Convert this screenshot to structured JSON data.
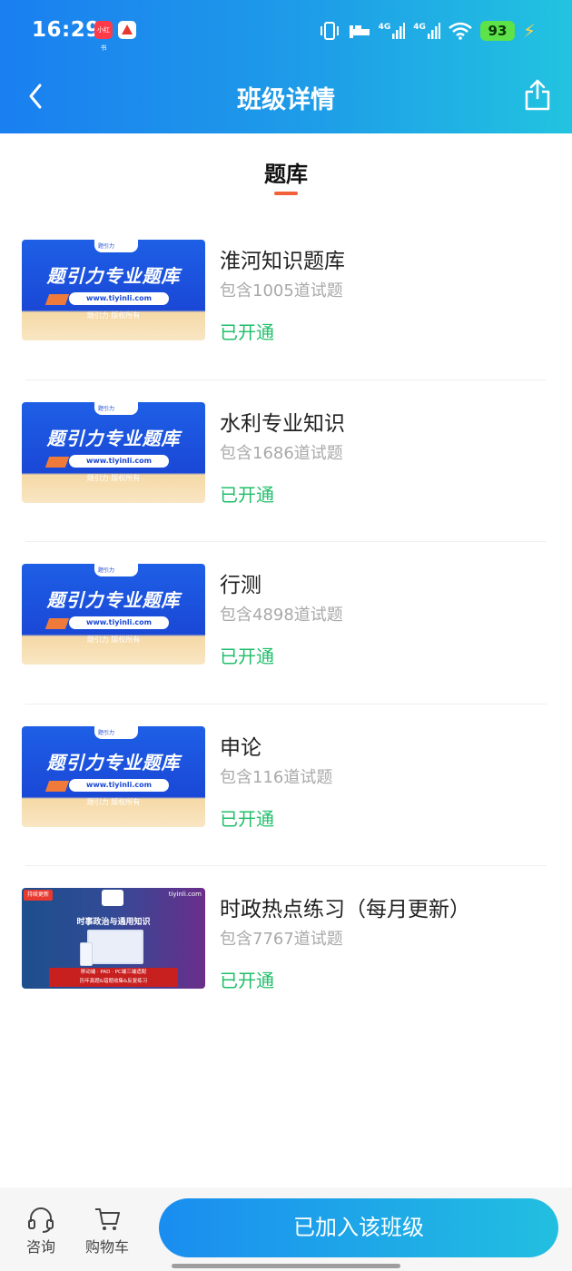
{
  "status_bar": {
    "time": "16:29",
    "app_badge_text": "小红书",
    "network_label_1": "4G",
    "network_label_2": "4G",
    "battery_level": "93"
  },
  "nav": {
    "title": "班级详情"
  },
  "tabs": [
    {
      "label": "题库",
      "active": true
    }
  ],
  "thumbnail_standard": {
    "brand_small": "题引力",
    "headline": "题引力专业题库",
    "url": "www.tiyinli.com",
    "copyright": "题引力 版权所有"
  },
  "thumbnail_alt": {
    "tag": "持续更新",
    "domain": "tiyinli.com",
    "subtitle": "时事政治与通用知识",
    "banner_line1": "移动端 · PAD · PC端三端适配",
    "banner_line2": "历年真题&错题收集&反复练习"
  },
  "items": [
    {
      "name": "淮河知识题库",
      "count": "包含1005道试题",
      "status": "已开通"
    },
    {
      "name": "水利专业知识",
      "count": "包含1686道试题",
      "status": "已开通"
    },
    {
      "name": "行测",
      "count": "包含4898道试题",
      "status": "已开通"
    },
    {
      "name": "申论",
      "count": "包含116道试题",
      "status": "已开通"
    },
    {
      "name": "时政热点练习（每月更新）",
      "count": "包含7767道试题",
      "status": "已开通"
    }
  ],
  "bottom_bar": {
    "consult_label": "咨询",
    "cart_label": "购物车",
    "join_label": "已加入该班级"
  },
  "colors": {
    "header_gradient_start": "#1a7ff0",
    "header_gradient_end": "#22c3e0",
    "active_tab_indicator": "#f2603a",
    "status_opened": "#1fbf6a",
    "count_text": "#a9a9a9"
  }
}
